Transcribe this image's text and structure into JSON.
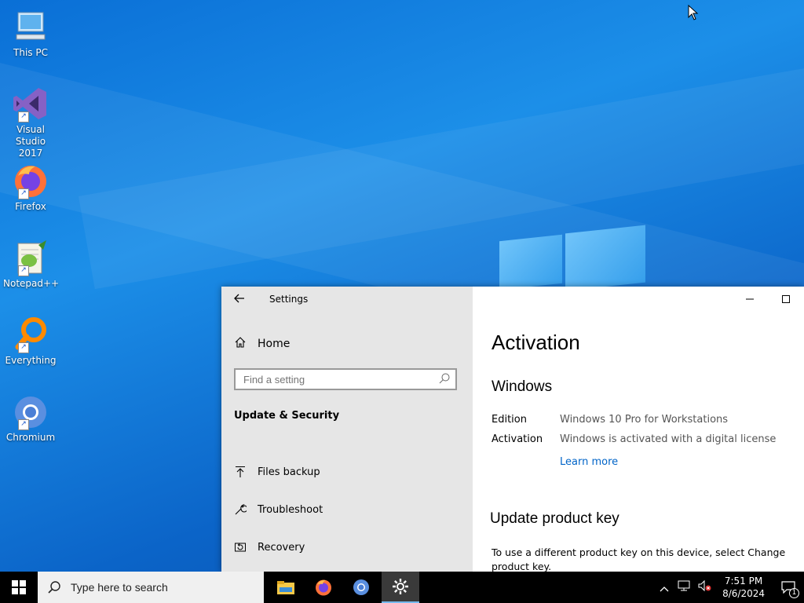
{
  "desktop": {
    "icons": [
      {
        "label": "This PC",
        "icon": "computer-icon"
      },
      {
        "label": "Visual Studio 2017",
        "icon": "visual-studio-icon"
      },
      {
        "label": "Firefox",
        "icon": "firefox-icon"
      },
      {
        "label": "Notepad++",
        "icon": "notepadpp-icon"
      },
      {
        "label": "Everything",
        "icon": "everything-search-icon"
      },
      {
        "label": "Chromium",
        "icon": "chromium-icon"
      }
    ]
  },
  "settings": {
    "app_title": "Settings",
    "back_icon": "back-arrow-icon",
    "home_label": "Home",
    "search_placeholder": "Find a setting",
    "section_title": "Update & Security",
    "nav": [
      {
        "label": "Files backup",
        "icon": "backup-arrow-icon"
      },
      {
        "label": "Troubleshoot",
        "icon": "wrench-icon"
      },
      {
        "label": "Recovery",
        "icon": "recovery-icon"
      }
    ],
    "window_buttons": {
      "minimize": "—",
      "maximize": "☐"
    },
    "main": {
      "title": "Activation",
      "windows_heading": "Windows",
      "edition_label": "Edition",
      "edition_value": "Windows 10 Pro for Workstations",
      "activation_label": "Activation",
      "activation_value": "Windows is activated with a digital license",
      "learn_more": "Learn more",
      "update_key_heading": "Update product key",
      "update_key_text": "To use a different product key on this device, select Change product key."
    }
  },
  "taskbar": {
    "search_placeholder": "Type here to search",
    "pinned": [
      {
        "name": "file-explorer-icon"
      },
      {
        "name": "firefox-icon"
      },
      {
        "name": "chromium-icon"
      },
      {
        "name": "settings-gear-icon",
        "active": true
      }
    ],
    "clock_time": "7:51 PM",
    "clock_date": "8/6/2024",
    "notification_count": "1"
  }
}
